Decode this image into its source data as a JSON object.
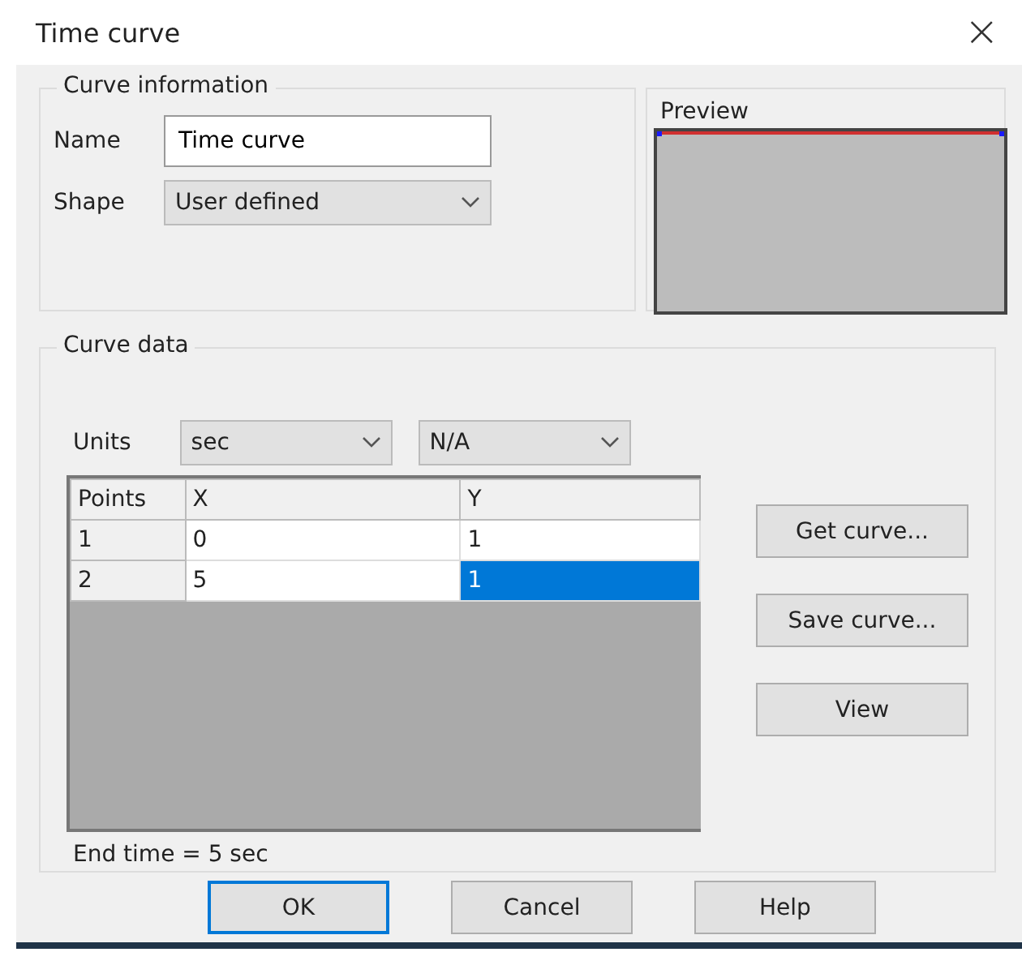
{
  "window": {
    "title": "Time curve",
    "close": "×"
  },
  "curve_information": {
    "title": "Curve information",
    "name_label": "Name",
    "name_value": "Time curve",
    "shape_label": "Shape",
    "shape_value": "User defined"
  },
  "preview": {
    "title": "Preview"
  },
  "curve_data": {
    "title": "Curve data",
    "units_label": "Units",
    "x_unit": "sec",
    "y_unit": "N/A",
    "table": {
      "columns": [
        "Points",
        "X",
        "Y"
      ],
      "rows": [
        {
          "cells": [
            {
              "text": "1",
              "selected": false
            },
            {
              "text": "0",
              "selected": false
            },
            {
              "text": "1",
              "selected": false
            }
          ]
        },
        {
          "cells": [
            {
              "text": "2",
              "selected": false
            },
            {
              "text": "5",
              "selected": false
            },
            {
              "text": "1",
              "selected": true
            }
          ]
        }
      ]
    },
    "side_buttons": [
      "Get curve...",
      "Save curve...",
      "View"
    ],
    "end_time": "End time = 5 sec"
  },
  "buttons": [
    {
      "label": "OK",
      "default": true
    },
    {
      "label": "Cancel",
      "default": false
    },
    {
      "label": "Help",
      "default": false
    }
  ]
}
